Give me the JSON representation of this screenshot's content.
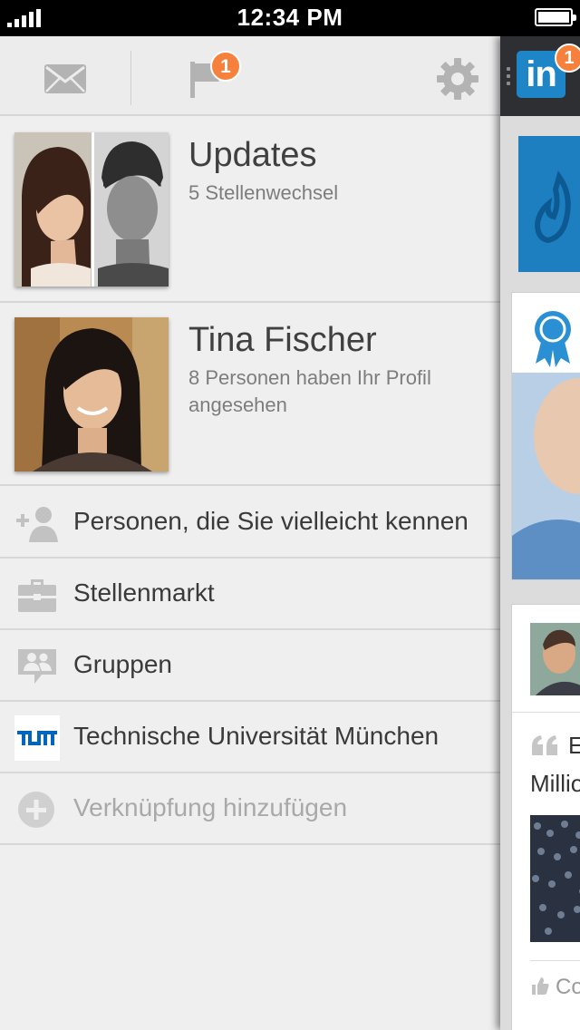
{
  "status_bar": {
    "time": "12:34 PM"
  },
  "top_bar": {
    "mail_icon": "envelope-icon",
    "notifications_icon": "flag-icon",
    "notifications_badge": "1",
    "settings_icon": "gear-icon"
  },
  "updates_card": {
    "title": "Updates",
    "subtitle": "5 Stellenwechsel"
  },
  "profile_card": {
    "name": "Tina Fischer",
    "subtitle": "8 Personen haben Ihr Profil angesehen"
  },
  "menu_items": [
    {
      "icon": "add-person-icon",
      "label": "Personen, die Sie vielleicht kennen"
    },
    {
      "icon": "briefcase-icon",
      "label": "Stellenmarkt"
    },
    {
      "icon": "groups-icon",
      "label": "Gruppen"
    },
    {
      "icon": "tum-logo-icon",
      "label": "Technische Universität München"
    },
    {
      "icon": "plus-circle-icon",
      "label": "Verknüpfung hinzufügen"
    }
  ],
  "content_strip": {
    "logo_text": "in",
    "logo_badge": "1",
    "quote_line1": "E",
    "quote_line2": "Millio",
    "action_text": "Co"
  },
  "colors": {
    "accent_blue": "#1e86c7",
    "badge_orange": "#f5813c",
    "tum_blue": "#0065bd"
  }
}
